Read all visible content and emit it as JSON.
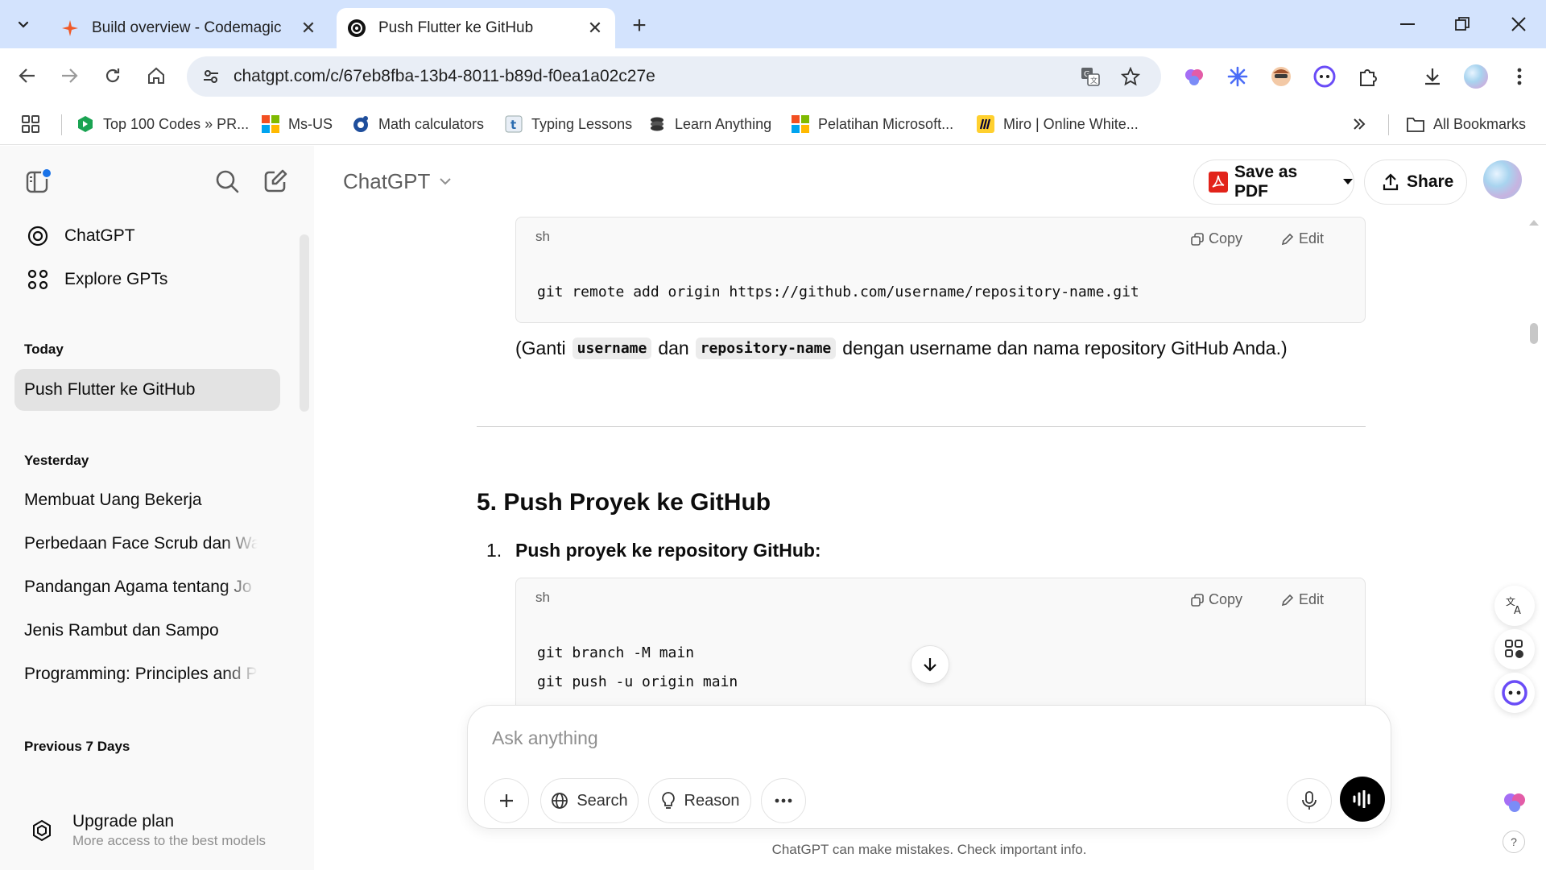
{
  "browser": {
    "tabs": [
      {
        "title": "Build overview - Codemagic",
        "active": false,
        "icon": "codemagic-icon"
      },
      {
        "title": "Push Flutter ke GitHub",
        "active": true,
        "icon": "openai-icon"
      }
    ],
    "url": "chatgpt.com/c/67eb8fba-13b4-8011-b89d-f0ea1a02c27e",
    "bookmarks": [
      {
        "label": "Top 100 Codes » PR...",
        "icon": "hexagon-icon"
      },
      {
        "label": "Ms-US",
        "icon": "microsoft-icon"
      },
      {
        "label": "Math calculators",
        "icon": "circle-o-icon"
      },
      {
        "label": "Typing Lessons",
        "icon": "t-icon"
      },
      {
        "label": "Learn Anything",
        "icon": "stack-icon"
      },
      {
        "label": "Pelatihan Microsoft...",
        "icon": "microsoft-icon"
      },
      {
        "label": "Miro | Online White...",
        "icon": "miro-icon"
      }
    ],
    "all_bookmarks": "All Bookmarks"
  },
  "sidebar": {
    "nav": [
      {
        "label": "ChatGPT",
        "icon": "openai-icon"
      },
      {
        "label": "Explore GPTs",
        "icon": "grid-icon"
      }
    ],
    "sections": [
      {
        "heading": "Today",
        "chats": [
          "Push Flutter ke GitHub"
        ]
      },
      {
        "heading": "Yesterday",
        "chats": [
          "Membuat Uang Bekerja",
          "Perbedaan Face Scrub dan Wa",
          "Pandangan Agama tentang Jo",
          "Jenis Rambut dan Sampo",
          "Programming: Principles and P"
        ]
      },
      {
        "heading": "Previous 7 Days",
        "chats": []
      }
    ],
    "upgrade": {
      "title": "Upgrade plan",
      "subtitle": "More access to the best models"
    }
  },
  "header": {
    "model": "ChatGPT",
    "save_pdf": "Save as PDF",
    "share": "Share"
  },
  "content": {
    "block1": {
      "lang": "sh",
      "copy": "Copy",
      "edit": "Edit",
      "lines": [
        "git remote add origin https://github.com/username/repository-name.git"
      ]
    },
    "note": {
      "pre": "(Ganti",
      "code1": "username",
      "mid": "dan",
      "code2": "repository-name",
      "post": "dengan username dan nama repository GitHub Anda.)"
    },
    "heading": "5. Push Proyek ke GitHub",
    "list_num": "1.",
    "list_text": "Push proyek ke repository GitHub:",
    "block2": {
      "lang": "sh",
      "copy": "Copy",
      "edit": "Edit",
      "lines": [
        "git branch -M main",
        "git push -u origin main"
      ]
    }
  },
  "composer": {
    "placeholder": "Ask anything",
    "search": "Search",
    "reason": "Reason"
  },
  "disclaimer": "ChatGPT can make mistakes. Check important info."
}
